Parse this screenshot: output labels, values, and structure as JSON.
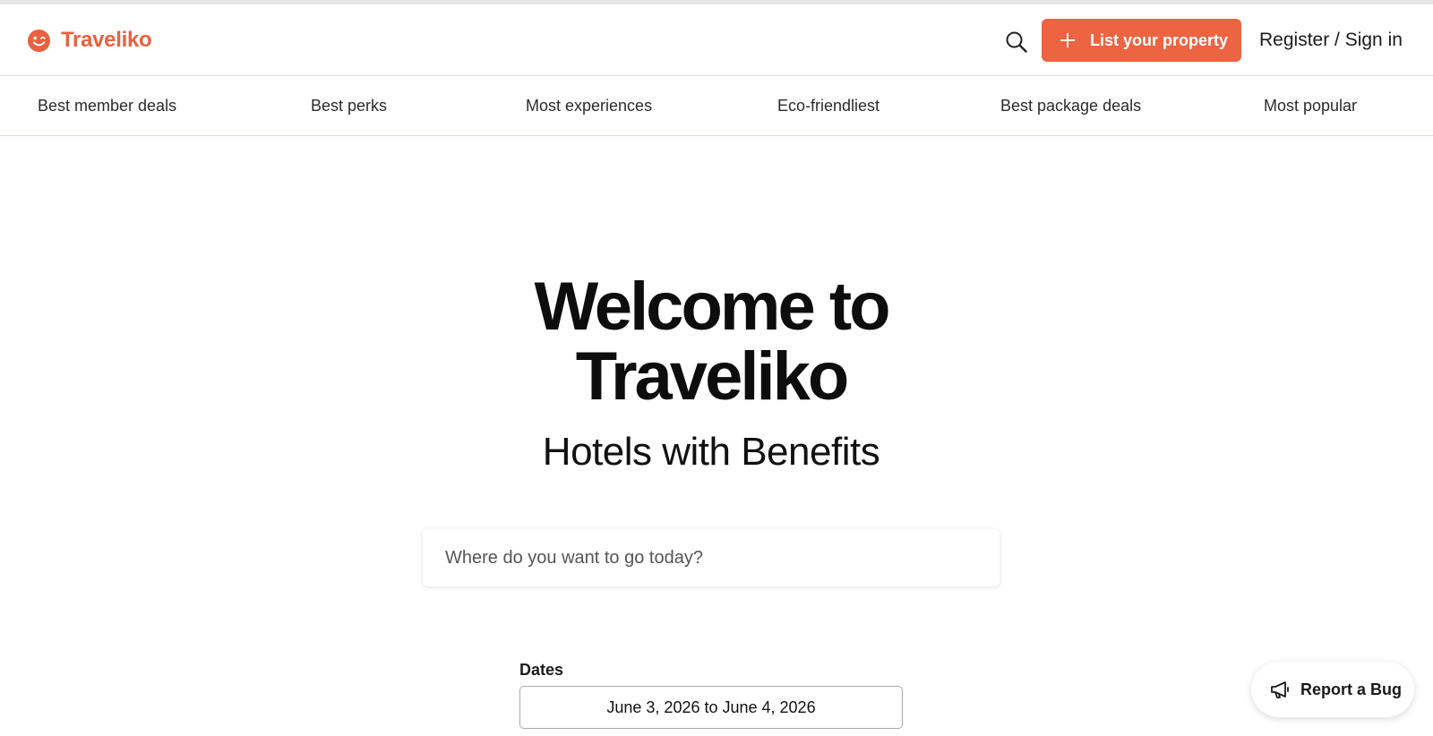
{
  "header": {
    "brand": "Traveliko",
    "list_property_label": "List your property",
    "signin_label": "Register / Sign in"
  },
  "categories": [
    "Best member deals",
    "Best perks",
    "Most experiences",
    "Eco-friendliest",
    "Best package deals",
    "Most popular"
  ],
  "hero": {
    "title_line1": "Welcome to",
    "title_line2": "Traveliko",
    "subtitle": "Hotels with Benefits"
  },
  "search": {
    "placeholder": "Where do you want to go today?",
    "value": ""
  },
  "dates": {
    "label": "Dates",
    "value": "June 3, 2026 to June 4, 2026"
  },
  "report_bug": {
    "label": "Report a Bug"
  },
  "colors": {
    "brand": "#e8623f",
    "button": "#ec6442"
  },
  "icons": {
    "logo": "smiley-icon",
    "search": "search-icon",
    "add": "plus-icon",
    "report": "megaphone-icon"
  }
}
